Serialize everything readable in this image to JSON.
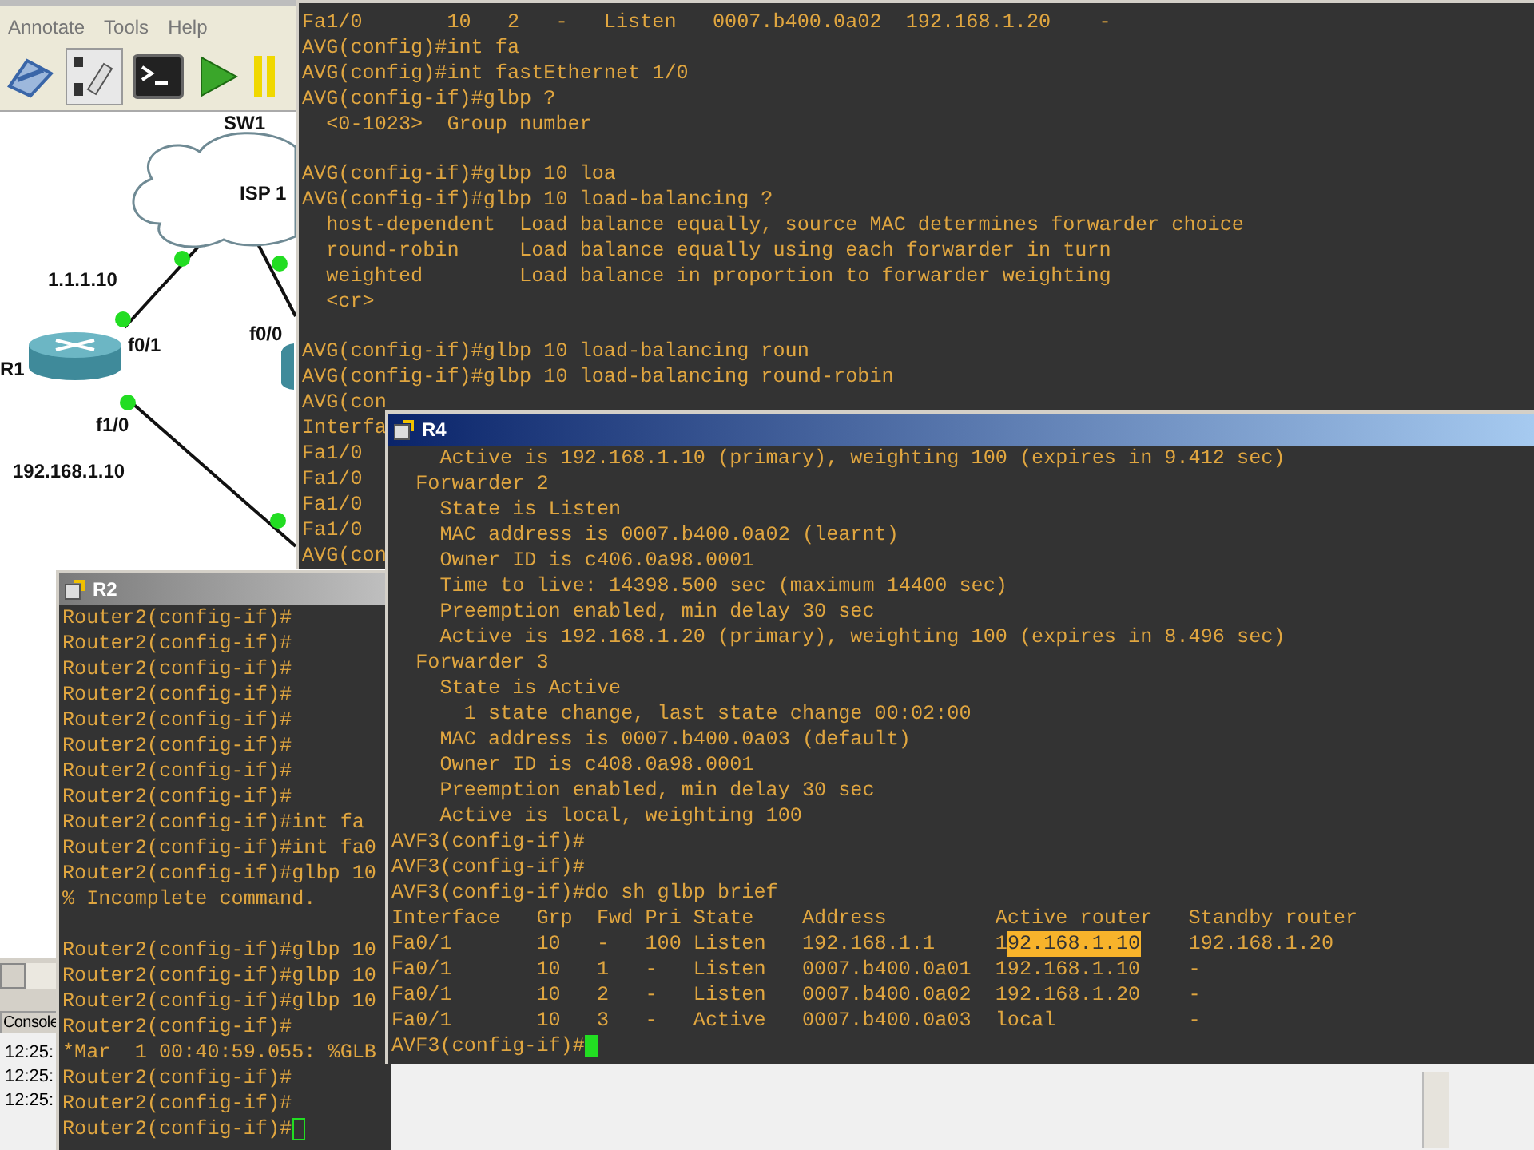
{
  "menu_bar": {
    "items": [
      "Annotate",
      "Tools",
      "Help"
    ]
  },
  "topology": {
    "labels": [
      "SW1",
      "ISP 1",
      "1.1.1.10",
      "f0/1",
      "R1",
      "f0/0",
      "f1/0",
      "192.168.1.10"
    ]
  },
  "console": {
    "tab": "Console",
    "lines": [
      "12:25:",
      "12:25:",
      "12:25:"
    ]
  },
  "avg_terminal": {
    "blocks": [
      [
        "Fa1/0       10   2   -   Listen   0007.b400.0a02  192.168.1.20    -",
        "AVG(config)#int fa",
        "AVG(config)#int fastEthernet 1/0",
        "AVG(config-if)#glbp ?",
        "  <0-1023>  Group number"
      ],
      [
        "AVG(config-if)#glbp 10 loa",
        "AVG(config-if)#glbp 10 load-balancing ?",
        "  host-dependent  Load balance equally, source MAC determines forwarder choice",
        "  round-robin     Load balance equally using each forwarder in turn",
        "  weighted        Load balance in proportion to forwarder weighting",
        "  <cr>"
      ],
      [
        "AVG(config-if)#glbp 10 load-balancing roun",
        "AVG(config-if)#glbp 10 load-balancing round-robin",
        "AVG(con",
        "Interfa",
        "Fa1/0",
        "Fa1/0",
        "Fa1/0",
        "Fa1/0",
        "AVG(con"
      ]
    ]
  },
  "r2_window": {
    "title": "R2",
    "active": false,
    "blocks": [
      [
        "Router2(config-if)#",
        "Router2(config-if)#",
        "Router2(config-if)#",
        "Router2(config-if)#",
        "Router2(config-if)#",
        "Router2(config-if)#",
        "Router2(config-if)#",
        "Router2(config-if)#",
        "Router2(config-if)#int fa",
        "Router2(config-if)#int fa0",
        "Router2(config-if)#glbp 10",
        "% Incomplete command."
      ],
      [
        "Router2(config-if)#glbp 10",
        "Router2(config-if)#glbp 10",
        "Router2(config-if)#glbp 10",
        "Router2(config-if)#",
        "*Mar  1 00:40:59.055: %GLB",
        "Router2(config-if)#",
        "Router2(config-if)#",
        "Router2(config-if)#"
      ]
    ]
  },
  "r4_window": {
    "title": "R4",
    "active": true,
    "blocks": [
      [
        "    Active is 192.168.1.10 (primary), weighting 100 (expires in 9.412 sec)",
        "  Forwarder 2",
        "    State is Listen",
        "    MAC address is 0007.b400.0a02 (learnt)",
        "    Owner ID is c406.0a98.0001",
        "    Time to live: 14398.500 sec (maximum 14400 sec)",
        "    Preemption enabled, min delay 30 sec",
        "    Active is 192.168.1.20 (primary), weighting 100 (expires in 8.496 sec)",
        "  Forwarder 3",
        "    State is Active",
        "      1 state change, last state change 00:02:00",
        "    MAC address is 0007.b400.0a03 (default)",
        "    Owner ID is c408.0a98.0001",
        "    Preemption enabled, min delay 30 sec",
        "    Active is local, weighting 100",
        "AVF3(config-if)#",
        "AVF3(config-if)#",
        "AVF3(config-if)#do sh glbp brief",
        "Interface   Grp  Fwd Pri State    Address         Active router   Standby router",
        {
          "segments": [
            {
              "text": "Fa0/1       10   -   100 Listen   192.168.1.1     1",
              "selected": false
            },
            {
              "text": "92.168.1.10",
              "selected": true
            },
            {
              "text": "    192.168.1.20",
              "selected": false
            }
          ]
        },
        "Fa0/1       10   1   -   Listen   0007.b400.0a01  192.168.1.10    -",
        "Fa0/1       10   2   -   Listen   0007.b400.0a02  192.168.1.20    -",
        "Fa0/1       10   3   -   Active   0007.b400.0a03  local           -",
        "AVF3(config-if)#"
      ]
    ]
  }
}
